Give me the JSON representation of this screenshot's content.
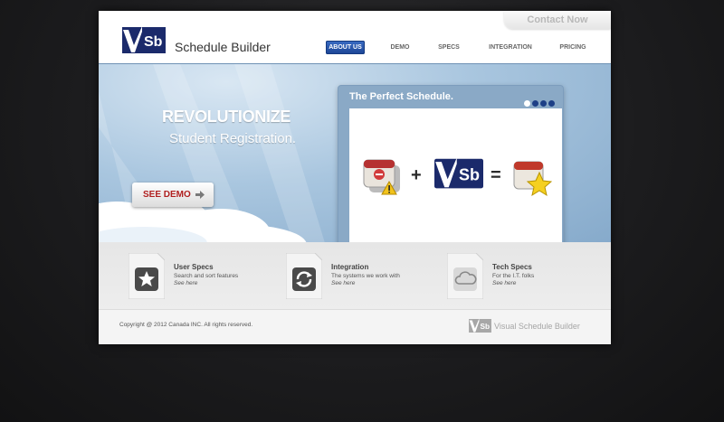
{
  "header": {
    "contact_label": "Contact Now",
    "logo_text": "Sb",
    "brand_name": "Schedule Builder"
  },
  "nav": {
    "items": [
      {
        "label": "ABOUT US",
        "active": true
      },
      {
        "label": "DEMO",
        "active": false
      },
      {
        "label": "SPECS",
        "active": false
      },
      {
        "label": "INTEGRATION",
        "active": false
      },
      {
        "label": "PRICING",
        "active": false
      }
    ]
  },
  "hero": {
    "headline": "REVOLUTIONIZE",
    "subline": "Student Registration.",
    "demo_button": "SEE DEMO",
    "demo_icon": "arrow-right-icon"
  },
  "slider": {
    "title": "The Perfect Schedule.",
    "dots": [
      {
        "active": true
      },
      {
        "active": false
      },
      {
        "active": false
      },
      {
        "active": false
      }
    ],
    "formula": {
      "plus": "+",
      "equals": "=",
      "logo_text": "Sb",
      "left_icon": "calendar-warning-icon",
      "right_icon": "calendar-star-icon"
    }
  },
  "features": [
    {
      "title": "User Specs",
      "desc": "Search and sort features",
      "link": "See here",
      "icon": "star-icon"
    },
    {
      "title": "Integration",
      "desc": "The systems we work with",
      "link": "See here",
      "icon": "sync-arrows-icon"
    },
    {
      "title": "Tech Specs",
      "desc": "For the I.T. folks",
      "link": "See here",
      "icon": "cloud-icon"
    }
  ],
  "footer": {
    "copyright": "Copyright @ 2012 Canada INC. All rights reserved.",
    "logo_text": "Sb",
    "brand": "Visual Schedule Builder"
  },
  "colors": {
    "brand_navy": "#1b2a6b",
    "nav_active": "#2552a8",
    "demo_red": "#b02020",
    "sky": "#a9c6df"
  }
}
